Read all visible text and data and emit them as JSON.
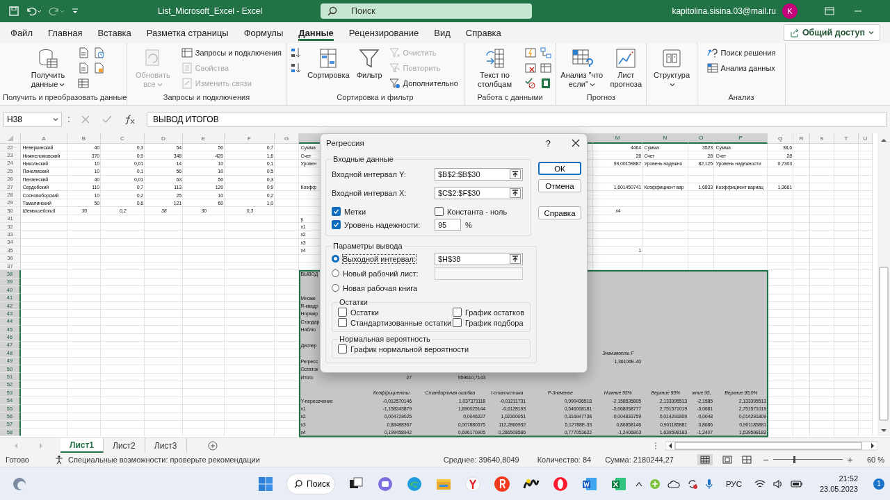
{
  "window": {
    "title": "List_Microsoft_Excel - Excel",
    "search": {
      "placeholder": "Поиск"
    },
    "account": "kapitolina.sisina.03@mail.ru",
    "avatar": "K"
  },
  "menu_tabs": [
    {
      "label": "Файл",
      "selected": false
    },
    {
      "label": "Главная",
      "selected": false
    },
    {
      "label": "Вставка",
      "selected": false
    },
    {
      "label": "Разметка страницы",
      "selected": false
    },
    {
      "label": "Формулы",
      "selected": false
    },
    {
      "label": "Данные",
      "selected": true
    },
    {
      "label": "Рецензирование",
      "selected": false
    },
    {
      "label": "Вид",
      "selected": false
    },
    {
      "label": "Справка",
      "selected": false
    }
  ],
  "share_button": "Общий доступ",
  "ribbon": {
    "groups": [
      {
        "label": "Получить и преобразовать данные",
        "items": [
          {
            "kind": "large",
            "label": "Получить данные",
            "dropdown": true,
            "disabled": false
          }
        ]
      },
      {
        "label": "Запросы и подключения",
        "items": [
          {
            "kind": "large",
            "label": "Обновить все",
            "dropdown": true,
            "disabled": true
          },
          {
            "kind": "small",
            "label": "Запросы и подключения",
            "disabled": false
          },
          {
            "kind": "small",
            "label": "Свойства",
            "disabled": true
          },
          {
            "kind": "small",
            "label": "Изменить связи",
            "disabled": true
          }
        ]
      },
      {
        "label": "Сортировка и фильтр",
        "items": [
          {
            "kind": "large",
            "label": "Сортировка",
            "dropdown": false,
            "disabled": false
          },
          {
            "kind": "large",
            "label": "Фильтр",
            "dropdown": false,
            "disabled": false
          },
          {
            "kind": "small",
            "label": "Очистить",
            "disabled": true
          },
          {
            "kind": "small",
            "label": "Повторить",
            "disabled": true
          },
          {
            "kind": "small",
            "label": "Дополнительно",
            "disabled": false
          }
        ]
      },
      {
        "label": "Работа с данными",
        "items": [
          {
            "kind": "large",
            "label": "Текст по столбцам",
            "dropdown": false,
            "disabled": false
          }
        ]
      },
      {
        "label": "Прогноз",
        "items": [
          {
            "kind": "large",
            "label": "Анализ \"что если\"",
            "dropdown": true,
            "disabled": false
          },
          {
            "kind": "large",
            "label": "Лист прогноза",
            "dropdown": false,
            "disabled": false
          }
        ]
      },
      {
        "items": [
          {
            "kind": "large",
            "label": "Структура",
            "dropdown": true,
            "disabled": false
          }
        ]
      },
      {
        "label": "Анализ",
        "items": [
          {
            "kind": "small",
            "label": "Поиск решения",
            "disabled": false
          },
          {
            "kind": "small",
            "label": "Анализ данных",
            "disabled": false
          }
        ]
      }
    ]
  },
  "formula_bar": {
    "name_box": "H38",
    "formula": "ВЫВОД ИТОГОВ"
  },
  "sheet": {
    "columns": [
      {
        "letter": "A",
        "selected": false
      },
      {
        "letter": "B",
        "selected": false
      },
      {
        "letter": "C",
        "selected": false
      },
      {
        "letter": "D",
        "selected": false
      },
      {
        "letter": "E",
        "selected": false
      },
      {
        "letter": "F",
        "selected": false
      },
      {
        "letter": "G",
        "selected": false
      },
      {
        "selected": true
      },
      {
        "selected": true
      },
      {
        "selected": true
      },
      {
        "selected": true
      },
      {
        "selected": true
      },
      {
        "letter": "M",
        "selected": true
      },
      {
        "letter": "N",
        "selected": true
      },
      {
        "letter": "O",
        "selected": true
      },
      {
        "letter": "P",
        "selected": true
      },
      {
        "letter": "Q",
        "selected": false
      },
      {
        "letter": "R",
        "selected": false
      },
      {
        "letter": "S",
        "selected": false
      },
      {
        "letter": "T",
        "selected": false
      },
      {
        "letter": "U",
        "selected": false
      }
    ],
    "rows": [
      {
        "number": "22",
        "kind": "stats",
        "selected": false,
        "italic": false,
        "cells": {
          "A": "Неверкинский",
          "B": "40",
          "C": "0,3",
          "D": "54",
          "E": "50",
          "F": "0,7",
          "H": "Сумма",
          "M": "4464",
          "N": "Сумма",
          "O": "3523",
          "P": "Сумма",
          "Q": "38,6"
        }
      },
      {
        "number": "23",
        "kind": "stats",
        "selected": false,
        "italic": false,
        "cells": {
          "A": "Нижнеломовский",
          "B": "370",
          "C": "0,9",
          "D": "348",
          "E": "420",
          "F": "1,6",
          "H": "Счет",
          "M": "28",
          "N": "Счет",
          "O": "28",
          "P": "Счет",
          "Q": "28"
        }
      },
      {
        "number": "24",
        "kind": "stats",
        "selected": false,
        "italic": false,
        "cells": {
          "A": "Никольский",
          "B": "10",
          "C": "0,01",
          "D": "14",
          "E": "10",
          "F": "0,1",
          "H": "Уровен",
          "M": "99,00159887",
          "N": "Уровень надежно",
          "O": "82,125",
          "P": "Уровень надежности",
          "Q": "0,7303"
        }
      },
      {
        "number": "25",
        "kind": "stats",
        "selected": false,
        "italic": false,
        "cells": {
          "A": "Пачелмский",
          "B": "10",
          "C": "0,1",
          "D": "56",
          "E": "10",
          "F": "0,5"
        }
      },
      {
        "number": "26",
        "kind": "stats",
        "selected": false,
        "italic": false,
        "cells": {
          "A": "Пензенский",
          "B": "40",
          "C": "0,01",
          "D": "63",
          "E": "50",
          "F": "0,3"
        }
      },
      {
        "number": "27",
        "kind": "stats",
        "selected": false,
        "italic": false,
        "cells": {
          "A": "Сердобский",
          "B": "110",
          "C": "0,7",
          "D": "113",
          "E": "120",
          "F": "0,9",
          "H": "Коэфф",
          "M": "1,601450741",
          "N": "Коэффициент вар",
          "O": "1,6833",
          "P": "Коэффициент вариац",
          "Q": "1,3661"
        }
      },
      {
        "number": "28",
        "kind": "stats",
        "selected": false,
        "italic": false,
        "cells": {
          "A": "Сосновоборский",
          "B": "10",
          "C": "0,2",
          "D": "25",
          "E": "10",
          "F": "0,2"
        }
      },
      {
        "number": "29",
        "kind": "plain",
        "selected": false,
        "italic": false,
        "cells": {
          "A": "Тамалинский",
          "B": "50",
          "C": "0,6",
          "D": "121",
          "E": "60",
          "F": "1,0"
        }
      },
      {
        "number": "30",
        "kind": "plain",
        "selected": false,
        "italic": true,
        "cells": {
          "A": "Шемышейский",
          "B": "30",
          "C": "0,2",
          "D": "38",
          "E": "30",
          "F": "0,3",
          "M": "x4"
        }
      },
      {
        "number": "31",
        "kind": "plain",
        "selected": false,
        "italic": false,
        "cells": {
          "H": "y"
        }
      },
      {
        "number": "32",
        "kind": "plain",
        "selected": false,
        "italic": false,
        "cells": {
          "H": "x1"
        }
      },
      {
        "number": "33",
        "kind": "plain",
        "selected": false,
        "italic": false,
        "cells": {
          "H": "x2"
        }
      },
      {
        "number": "34",
        "kind": "plain",
        "selected": false,
        "italic": false,
        "cells": {
          "H": "x3"
        }
      },
      {
        "number": "35",
        "kind": "plain",
        "selected": false,
        "italic": false,
        "cells": {
          "H": "x4",
          "M": "1"
        }
      },
      {
        "number": "36",
        "kind": "plain",
        "selected": false
      },
      {
        "number": "37",
        "kind": "plain",
        "selected": false
      },
      {
        "number": "38",
        "kind": "plain",
        "selected": true,
        "italic": false,
        "cells": {
          "H": "ВЫВОД"
        }
      },
      {
        "number": "39",
        "kind": "plain",
        "selected": true
      },
      {
        "number": "40",
        "kind": "plain",
        "selected": true
      },
      {
        "number": "41",
        "kind": "plain",
        "selected": true,
        "italic": false,
        "cells": {
          "H": "Множе"
        }
      },
      {
        "number": "42",
        "kind": "plain",
        "selected": true,
        "italic": false,
        "cells": {
          "H": "R-квадр"
        }
      },
      {
        "number": "43",
        "kind": "plain",
        "selected": true,
        "italic": false,
        "cells": {
          "H": "Нормир"
        }
      },
      {
        "number": "44",
        "kind": "plain",
        "selected": true,
        "italic": false,
        "cells": {
          "H": "Стандар"
        }
      },
      {
        "number": "45",
        "kind": "plain",
        "selected": true,
        "italic": false,
        "cells": {
          "H": "Наблю"
        }
      },
      {
        "number": "46",
        "kind": "plain",
        "selected": true
      },
      {
        "number": "47",
        "kind": "plain",
        "selected": true,
        "italic": false,
        "cells": {
          "H": "Диспер"
        }
      },
      {
        "number": "48",
        "kind": "plain",
        "selected": true,
        "italic": true,
        "cells": {
          "M": "Значимость F"
        }
      },
      {
        "number": "49",
        "kind": "plain",
        "selected": true,
        "italic": false,
        "cells": {
          "H": "Регресс",
          "M": "1,36106E-40"
        }
      },
      {
        "number": "50",
        "kind": "plain",
        "selected": true,
        "italic": false,
        "cells": {
          "H": "Остаток"
        }
      },
      {
        "number": "51",
        "kind": "plain",
        "selected": true,
        "italic": false,
        "cells": {
          "H": "Итого",
          "I": "27",
          "J": "959610,7143"
        }
      },
      {
        "number": "52",
        "kind": "plain",
        "selected": true
      },
      {
        "number": "53",
        "kind": "plain",
        "selected": true,
        "italic": true,
        "cells": {
          "I": "Коэффициенты",
          "J": "Стандартная ошибка",
          "K": "t-статистика",
          "L": "P-Значение",
          "M": "Нижние 95%",
          "N": "Верхние 95%",
          "O": "жние 95,",
          "P": "Верхние 95,0%"
        }
      },
      {
        "number": "54",
        "kind": "plain",
        "selected": true,
        "italic": false,
        "cells": {
          "H": "Y-пересечение",
          "I": "-0,012570146",
          "J": "1,037371118",
          "K": "-0,01211731",
          "L": "0,990436518",
          "M": "-2,158535805",
          "N": "2,133395513",
          "O": "-2,1585",
          "P": "2,133395513"
        }
      },
      {
        "number": "55",
        "kind": "plain",
        "selected": true,
        "italic": false,
        "cells": {
          "H": "x1",
          "I": "-1,158243879",
          "J": "1,890025144",
          "K": "-0,6128193",
          "L": "0,546008181",
          "M": "-5,068058777",
          "N": "2,751571019",
          "O": "-5,0681",
          "P": "2,751571019"
        }
      },
      {
        "number": "56",
        "kind": "plain",
        "selected": true,
        "italic": false,
        "cells": {
          "H": "x2",
          "I": "0,004729025",
          "J": "0,0046227",
          "K": "1,02300051",
          "L": "0,316947738",
          "M": "-0,004833759",
          "N": "0,014291809",
          "O": "-0,0048",
          "P": "0,014291809"
        }
      },
      {
        "number": "57",
        "kind": "plain",
        "selected": true,
        "italic": false,
        "cells": {
          "H": "x3",
          "I": "0,88488367",
          "J": "0,007880575",
          "K": "112,2866932",
          "L": "5,12788E-33",
          "M": "0,86858146",
          "N": "0,901185881",
          "O": "0,8686",
          "P": "0,901185881"
        }
      },
      {
        "number": "58",
        "kind": "plain",
        "selected": true,
        "italic": false,
        "cells": {
          "H": "x4",
          "I": "0,199458942",
          "J": "0,696170905",
          "K": "0,286508586",
          "L": "0,777053622",
          "M": "-1,2406803",
          "N": "1,639598183",
          "O": "-1,2407",
          "P": "1,639598183"
        }
      }
    ]
  },
  "dialog": {
    "title": "Регрессия",
    "help": "?",
    "input_group": {
      "title": "Входные данные",
      "fields": [
        {
          "label": "Входной интервал Y:",
          "value": "$B$2:$B$30"
        },
        {
          "label": "Входной интервал X:",
          "value": "$C$2:$F$30"
        }
      ],
      "labels": {
        "label": "Метки",
        "checked": true
      },
      "constant_zero": {
        "label": "Константа - ноль",
        "checked": false
      },
      "confidence": {
        "label": "Уровень надежности:",
        "checked": true,
        "value": "95",
        "unit": "%"
      }
    },
    "output_group": {
      "title": "Параметры вывода",
      "options": [
        {
          "kind": "range",
          "label": "Выходной интервал:",
          "selected": true,
          "value": "$H$38"
        },
        {
          "kind": "sheet",
          "label": "Новый рабочий лист:",
          "selected": false
        },
        {
          "kind": "book",
          "label": "Новая рабочая книга",
          "selected": false
        }
      ],
      "residuals": {
        "title": "Остатки",
        "options": [
          {
            "label": "Остатки",
            "checked": false
          },
          {
            "label": "График остатков",
            "checked": false
          },
          {
            "label": "Стандартизованные остатки",
            "checked": false
          },
          {
            "label": "График подбора",
            "checked": false
          }
        ]
      },
      "normal": {
        "title": "Нормальная вероятность",
        "options": [
          {
            "label": "График нормальной вероятности",
            "checked": false
          }
        ]
      }
    },
    "buttons": [
      {
        "label": "ОК",
        "kind": "default"
      },
      {
        "label": "Отмена",
        "kind": "plain"
      },
      {
        "label": "Справка",
        "kind": "plain"
      }
    ]
  },
  "sheet_tabs": [
    {
      "label": "Лист1",
      "selected": true
    },
    {
      "label": "Лист2",
      "selected": false
    },
    {
      "label": "Лист3",
      "selected": false
    }
  ],
  "status_bar": {
    "status": "Готово",
    "accessibility": "Специальные возможности: проверьте рекомендации",
    "average": "Среднее: 39640,8049",
    "count": "Количество: 84",
    "sum": "Сумма: 2180244,27",
    "zoom": {
      "level": 0.3,
      "reading": "60 %"
    }
  },
  "taskbar": {
    "search": "Поиск",
    "language": "РУС",
    "time": "21:52",
    "date": "23.05.2023",
    "notifications": "1"
  }
}
